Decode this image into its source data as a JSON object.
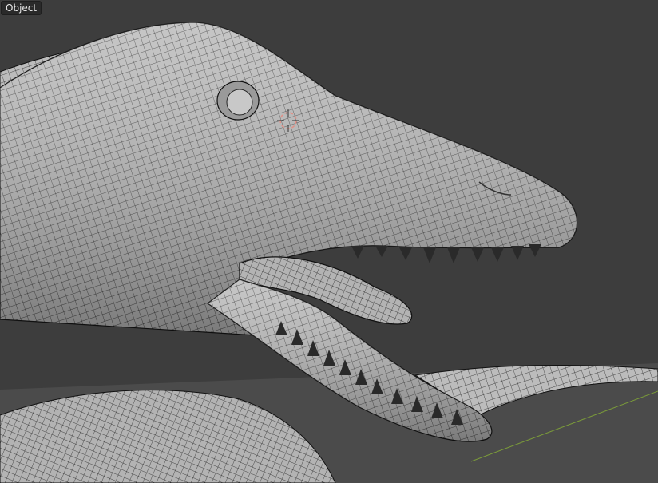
{
  "viewport": {
    "mode_label": "Object",
    "background_color": "#3d3d3d",
    "floor_color": "#4b4b4b",
    "mesh_fill_color": "#bdbdbd",
    "wire_color": "#1a1a1a",
    "cursor_color": "#e08f85",
    "grid_axis_color": "#7a9a3a"
  }
}
